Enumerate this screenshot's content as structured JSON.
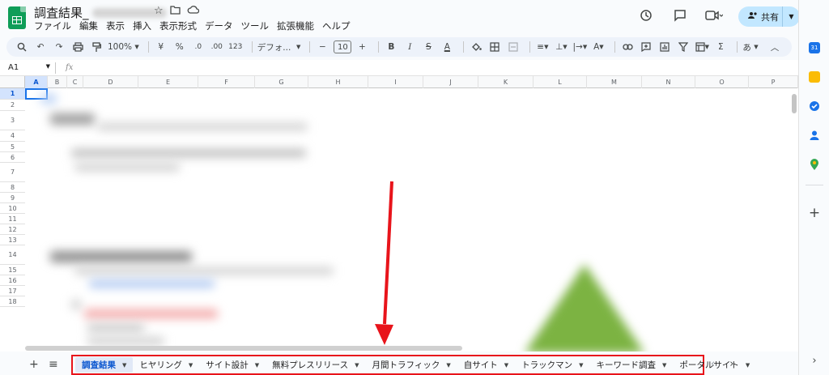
{
  "header": {
    "title": "調査結果_",
    "menu": [
      "ファイル",
      "編集",
      "表示",
      "挿入",
      "表示形式",
      "データ",
      "ツール",
      "拡張機能",
      "ヘルプ"
    ],
    "share_label": "共有"
  },
  "toolbar": {
    "zoom": "100%",
    "currency": "¥",
    "percent": "%",
    "dec_decrease": ".0",
    "dec_increase": ".00",
    "number_format": "123",
    "font": "デフォ...",
    "font_size": "10",
    "bold": "B",
    "italic": "I",
    "strike": "S",
    "text_color": "A",
    "input_tools": "あ"
  },
  "formula_bar": {
    "cell_ref": "A1",
    "fx": "fx"
  },
  "grid": {
    "columns": [
      "A",
      "B",
      "C",
      "D",
      "E",
      "F",
      "G",
      "H",
      "I",
      "J",
      "K",
      "L",
      "M",
      "N",
      "O",
      "P"
    ],
    "rows": [
      "1",
      "2",
      "3",
      "4",
      "5",
      "6",
      "7",
      "8",
      "9",
      "10",
      "11",
      "12",
      "13",
      "14",
      "15",
      "16",
      "17",
      "18"
    ]
  },
  "sheets": {
    "tabs": [
      "調査結果",
      "ヒヤリング",
      "サイト設計",
      "無料プレスリリース",
      "月間トラフィック",
      "自サイト",
      "トラックマン",
      "キーワード調査",
      "ポータルサイト"
    ],
    "active_index": 0
  },
  "colors": {
    "accent": "#0b57d0",
    "highlight_border": "#e8141b",
    "arrow": "#e8141b",
    "sheets_green": "#0f9d58"
  }
}
